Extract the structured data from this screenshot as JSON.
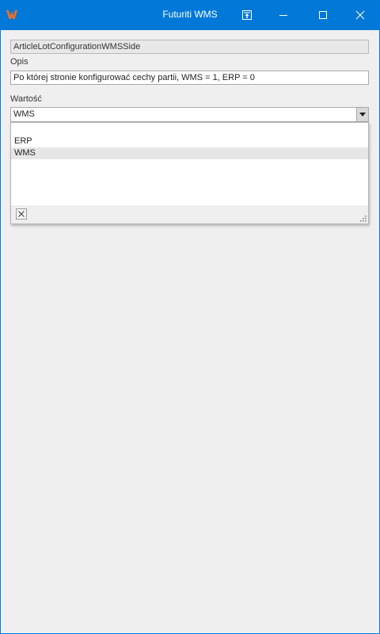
{
  "window": {
    "title": "Futuriti WMS",
    "accent": "#0078d7",
    "icons": [
      "app-logo-icon",
      "restore-to-top-icon",
      "minimize-icon",
      "maximize-icon",
      "close-icon"
    ]
  },
  "form": {
    "key_value": "ArticleLotConfigurationWMSSide",
    "description_label": "Opis",
    "description_value": "Po której stronie konfigurować cechy partii, WMS = 1, ERP = 0",
    "value_label": "Wartość",
    "value_selected": "WMS",
    "options": [
      "",
      "ERP",
      "WMS"
    ],
    "highlighted_option": "WMS"
  }
}
